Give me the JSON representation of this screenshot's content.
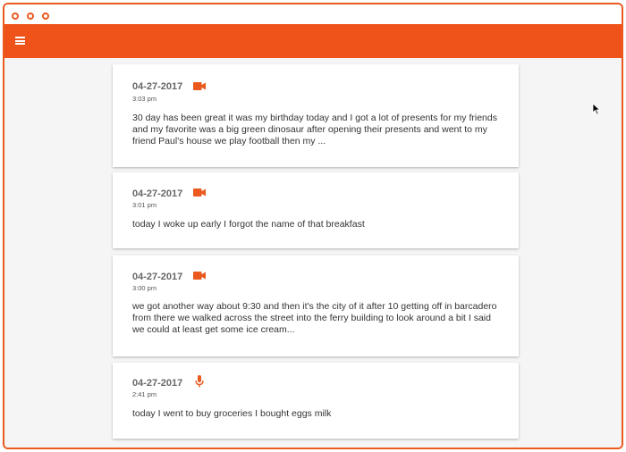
{
  "window": {
    "title_dots": [
      "dot-1",
      "dot-2",
      "dot-3"
    ]
  },
  "appbar": {
    "menu_icon": "hamburger-menu-icon",
    "color": "#ef5319"
  },
  "entries": [
    {
      "date": "04-27-2017",
      "time": "3:03 pm",
      "type": "video-camera-icon",
      "text": "30 day has been great it was my birthday today and I got a lot of presents for my friends and my favorite was a big green dinosaur after opening their presents and went to my friend Paul's house we play football then my ..."
    },
    {
      "date": "04-27-2017",
      "time": "3:01 pm",
      "type": "video-camera-icon",
      "text": "today I woke up early I forgot the name of that breakfast"
    },
    {
      "date": "04-27-2017",
      "time": "3:00 pm",
      "type": "video-camera-icon",
      "text": "we got another way about 9:30 and then it's the city of it after 10 getting off in barcadero from there we walked across the street into the ferry building to look around a bit I said we could at least get some ice cream..."
    },
    {
      "date": "04-27-2017",
      "time": "2:41 pm",
      "type": "microphone-icon",
      "text": "today I went to buy groceries I bought eggs milk"
    }
  ],
  "accent_color": "#ea5a1f"
}
